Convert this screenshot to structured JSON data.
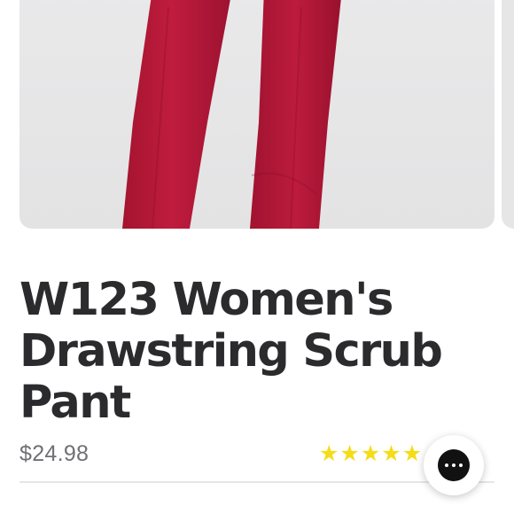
{
  "product": {
    "title": "W123 Women's Drawstring Scrub Pant",
    "price": "$24.98",
    "rating": 5,
    "rating_max": 5,
    "garment_color": "#b5183a",
    "gallery_background": "#e6e6e7"
  },
  "stars": [
    "★",
    "★",
    "★",
    "★",
    "★"
  ],
  "star_color": "#f5dc17",
  "chat": {
    "icon": "chat-bubble-dots-icon"
  }
}
